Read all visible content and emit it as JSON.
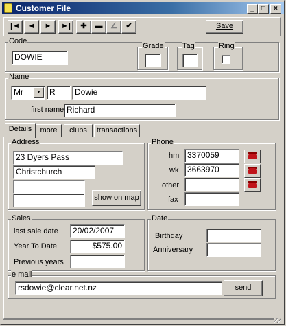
{
  "window": {
    "title": "Customer File"
  },
  "toolbar": {
    "save_label": "Save",
    "nav": [
      {
        "icon": "first-record-icon",
        "glyph": "|◄"
      },
      {
        "icon": "previous-record-icon",
        "glyph": "◄"
      },
      {
        "icon": "next-record-icon",
        "glyph": "►"
      },
      {
        "icon": "last-record-icon",
        "glyph": "►|"
      },
      {
        "icon": "add-record-icon",
        "glyph": "✚"
      },
      {
        "icon": "delete-record-icon",
        "glyph": "▬"
      },
      {
        "icon": "edit-record-icon",
        "glyph": "∠"
      },
      {
        "icon": "confirm-record-icon",
        "glyph": "✔"
      }
    ]
  },
  "code_section": {
    "label": "Code",
    "value": "DOWIE",
    "grade_label": "Grade",
    "grade_value": "",
    "tag_label": "Tag",
    "tag_value": "",
    "ring_label": "Ring",
    "ring_checked": false
  },
  "name_section": {
    "label": "Name",
    "title_value": "Mr",
    "initial_value": "R",
    "surname_value": "Dowie",
    "first_name_label": "first name",
    "first_name_value": "Richard"
  },
  "tabs": [
    {
      "label": "Details"
    },
    {
      "label": "more"
    },
    {
      "label": "clubs"
    },
    {
      "label": "transactions"
    }
  ],
  "address_section": {
    "label": "Address",
    "lines": [
      "23 Dyers Pass",
      "Christchurch",
      "",
      ""
    ],
    "show_on_map_label": "show on map"
  },
  "phone_section": {
    "label": "Phone",
    "rows": [
      {
        "label": "hm",
        "value": "3370059"
      },
      {
        "label": "wk",
        "value": "3663970"
      },
      {
        "label": "other",
        "value": ""
      },
      {
        "label": "fax",
        "value": ""
      }
    ]
  },
  "sales_section": {
    "label": "Sales",
    "last_sale_label": "last sale date",
    "last_sale_value": "20/02/2007",
    "ytd_label": "Year To Date",
    "ytd_value": "$575.00",
    "prev_label": "Previous years",
    "prev_value": ""
  },
  "date_section": {
    "label": "Date",
    "birthday_label": "Birthday",
    "birthday_value": "",
    "anniversary_label": "Anniversary",
    "anniversary_value": ""
  },
  "email_section": {
    "label": "e mail",
    "value": "rsdowie@clear.net.nz",
    "send_label": "send"
  },
  "colors": {
    "titlebar": "#0a246a",
    "face": "#d4d0c8",
    "phone_icon": "#c0141a"
  }
}
